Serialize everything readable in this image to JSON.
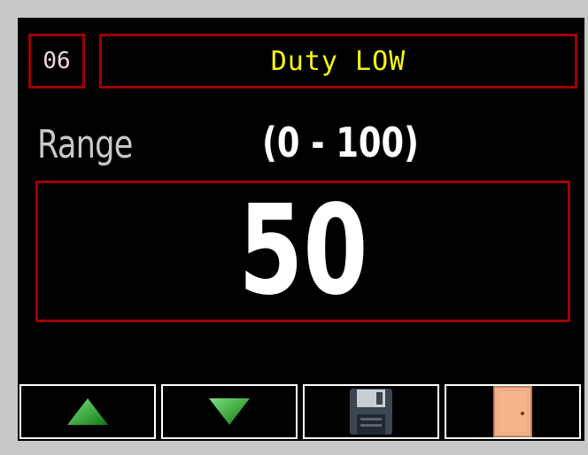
{
  "header": {
    "number": "06",
    "title": "Duty LOW"
  },
  "range": {
    "label": "Range",
    "value": "(0 - 100)"
  },
  "current_value": "50",
  "buttons": [
    {
      "icon": "arrow-up-icon"
    },
    {
      "icon": "arrow-down-icon"
    },
    {
      "icon": "floppy-disk-icon"
    },
    {
      "icon": "door-icon"
    }
  ],
  "colors": {
    "border": "#a00000",
    "title": "#f7f710",
    "background": "#000000",
    "arrow": "#22a822",
    "door": "#f4b48c"
  }
}
